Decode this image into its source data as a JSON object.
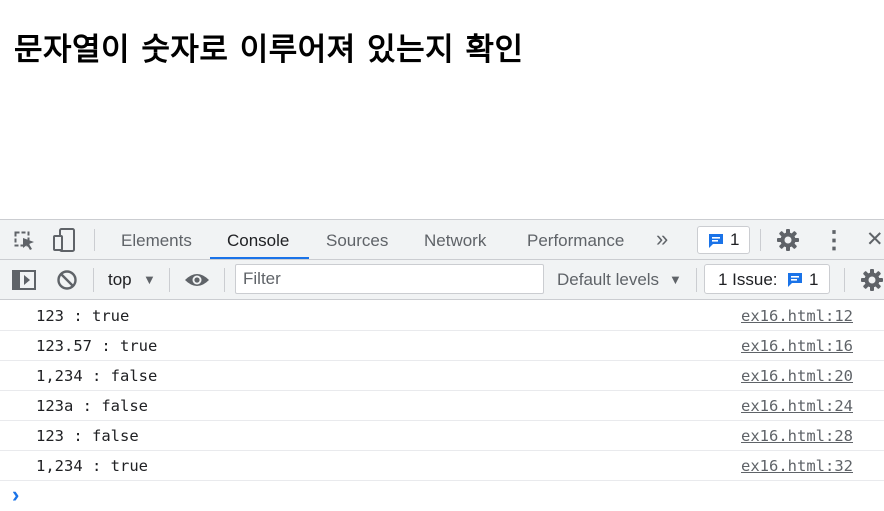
{
  "page": {
    "heading": "문자열이 숫자로 이루어져 있는지 확인"
  },
  "devtools": {
    "tabs": [
      {
        "label": "Elements",
        "active": false
      },
      {
        "label": "Console",
        "active": true
      },
      {
        "label": "Sources",
        "active": false
      },
      {
        "label": "Network",
        "active": false
      },
      {
        "label": "Performance",
        "active": false
      }
    ],
    "more_tabs_glyph": "»",
    "issue_count": "1",
    "menu_glyph": "⋮",
    "close_glyph": "✕"
  },
  "console_toolbar": {
    "context": "top",
    "dropdown_glyph": "▼",
    "filter_placeholder": "Filter",
    "levels": "Default levels",
    "issues_label": "1 Issue:",
    "issues_count": "1"
  },
  "console": {
    "messages": [
      {
        "text": "123 : true",
        "source": "ex16.html:12"
      },
      {
        "text": "123.57 : true",
        "source": "ex16.html:16"
      },
      {
        "text": "1,234 : false",
        "source": "ex16.html:20"
      },
      {
        "text": "123a : false",
        "source": "ex16.html:24"
      },
      {
        "text": "123 : false",
        "source": "ex16.html:28"
      },
      {
        "text": "1,234 : true",
        "source": "ex16.html:32"
      }
    ],
    "prompt_glyph": "›"
  },
  "colors": {
    "accent": "#1a73e8",
    "toolbar_bg": "#f1f3f4",
    "icon": "#5f6368",
    "divider": "#cbcdd1"
  }
}
